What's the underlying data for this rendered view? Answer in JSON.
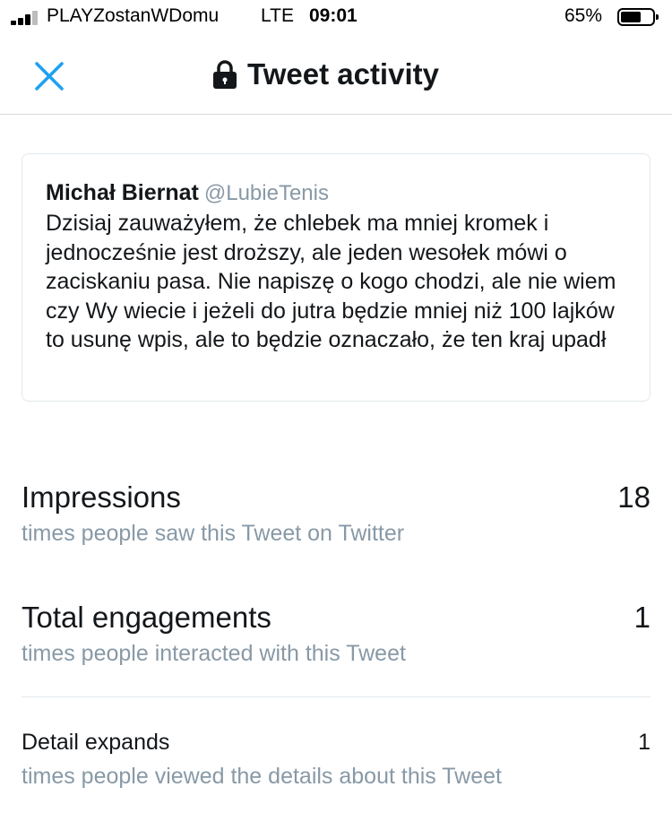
{
  "status_bar": {
    "carrier": "PLAYZostanWDomu",
    "network": "LTE",
    "time": "09:01",
    "battery_percent": "65%",
    "battery_level": 0.65
  },
  "nav": {
    "title": "Tweet activity",
    "icons": {
      "close": "close-icon",
      "lock": "lock-icon"
    },
    "accent_color": "#1da1f2"
  },
  "tweet": {
    "author": "Michał Biernat",
    "handle": "@LubieTenis",
    "text": "Dzisiaj zauważyłem, że chlebek ma mniej kromek i jednocześnie jest droższy, ale jeden wesołek mówi o zaciskaniu pasa. Nie napiszę o kogo chodzi, ale nie wiem czy Wy wiecie i jeżeli do jutra będzie mniej niż 100 lajków to usunę wpis, ale to będzie oznaczało, że ten kraj upadł"
  },
  "metrics": {
    "impressions": {
      "label": "Impressions",
      "description": "times people saw this Tweet on Twitter",
      "value": "18"
    },
    "engagements": {
      "label": "Total engagements",
      "description": "times people interacted with this Tweet",
      "value": "1"
    },
    "detail_expands": {
      "label": "Detail expands",
      "description": "times people viewed the details about this Tweet",
      "value": "1"
    }
  },
  "colors": {
    "secondary_text": "#8899a6",
    "primary_text": "#14171a",
    "border": "#e1e8ed"
  }
}
